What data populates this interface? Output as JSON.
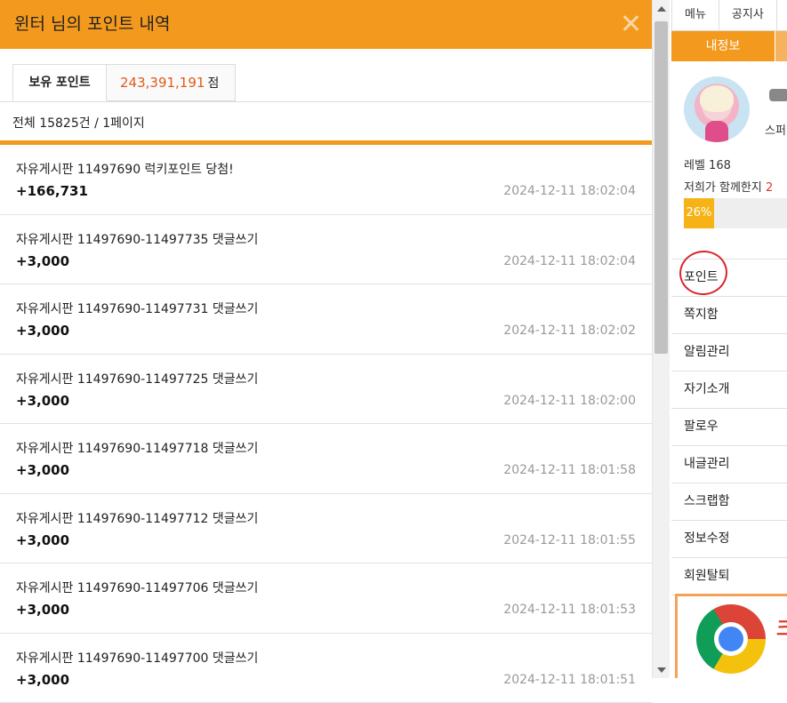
{
  "popup": {
    "title": "윈터 님의 포인트 내역",
    "tabs": {
      "label": "보유 포인트",
      "value": "243,391,191",
      "unit": "점"
    },
    "summary": "전체 15825건 / 1페이지",
    "rows": [
      {
        "desc": "자유게시판 11497690 럭키포인트 당첨!",
        "amount": "+166,731",
        "date": "2024-12-11 18:02:04"
      },
      {
        "desc": "자유게시판 11497690-11497735 댓글쓰기",
        "amount": "+3,000",
        "date": "2024-12-11 18:02:04"
      },
      {
        "desc": "자유게시판 11497690-11497731 댓글쓰기",
        "amount": "+3,000",
        "date": "2024-12-11 18:02:02"
      },
      {
        "desc": "자유게시판 11497690-11497725 댓글쓰기",
        "amount": "+3,000",
        "date": "2024-12-11 18:02:00"
      },
      {
        "desc": "자유게시판 11497690-11497718 댓글쓰기",
        "amount": "+3,000",
        "date": "2024-12-11 18:01:58"
      },
      {
        "desc": "자유게시판 11497690-11497712 댓글쓰기",
        "amount": "+3,000",
        "date": "2024-12-11 18:01:55"
      },
      {
        "desc": "자유게시판 11497690-11497706 댓글쓰기",
        "amount": "+3,000",
        "date": "2024-12-11 18:01:53"
      },
      {
        "desc": "자유게시판 11497690-11497700 댓글쓰기",
        "amount": "+3,000",
        "date": "2024-12-11 18:01:51"
      }
    ]
  },
  "background": {
    "topnav": [
      "메뉴",
      "공지사"
    ],
    "info_tab": "내정보",
    "nickname_partial": "스퍼",
    "level": "레벨 168",
    "together_prefix": "저희가 함께한지 ",
    "together_partial": "2",
    "progress": {
      "label": "26%",
      "percent": 26
    },
    "menu": [
      "포인트",
      "쪽지함",
      "알림관리",
      "자기소개",
      "팔로우",
      "내글관리",
      "스크랩함",
      "정보수정",
      "회원탈퇴"
    ],
    "ad_text_partial": "크"
  },
  "icons": {
    "close": "close-icon",
    "browser": "chrome-logo-icon"
  },
  "colors": {
    "accent": "#f39a1e",
    "points": "#e05a1c",
    "progress": "#f6b317",
    "highlight": "#d8262e"
  }
}
